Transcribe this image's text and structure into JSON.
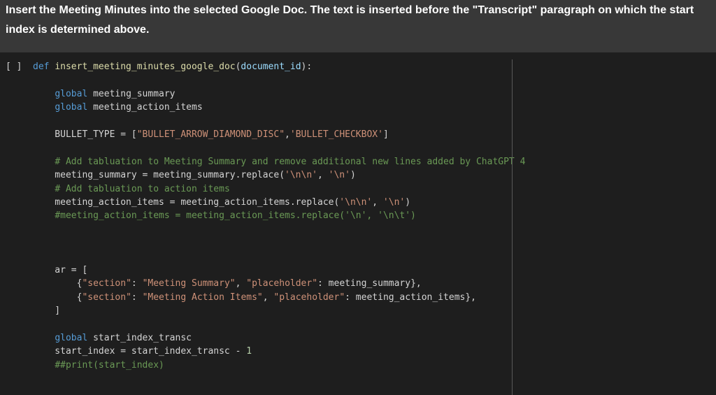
{
  "header": {
    "text": "Insert the Meeting Minutes into the selected Google Doc. The text is inserted before the \"Transcript\" paragraph on which the start index is determined above."
  },
  "cell": {
    "run_label": "[ ]"
  },
  "code_lines": [
    [
      [
        "keyword",
        "def"
      ],
      [
        "plain",
        " "
      ],
      [
        "function",
        "insert_meeting_minutes_google_doc"
      ],
      [
        "plain",
        "("
      ],
      [
        "param",
        "document_id"
      ],
      [
        "plain",
        "):"
      ]
    ],
    [],
    [
      [
        "plain",
        "    "
      ],
      [
        "keyword",
        "global"
      ],
      [
        "plain",
        " meeting_summary"
      ]
    ],
    [
      [
        "plain",
        "    "
      ],
      [
        "keyword",
        "global"
      ],
      [
        "plain",
        " meeting_action_items"
      ]
    ],
    [],
    [
      [
        "plain",
        "    BULLET_TYPE = ["
      ],
      [
        "string",
        "\"BULLET_ARROW_DIAMOND_DISC\""
      ],
      [
        "plain",
        ","
      ],
      [
        "string",
        "'BULLET_CHECKBOX'"
      ],
      [
        "plain",
        "]"
      ]
    ],
    [],
    [
      [
        "plain",
        "    "
      ],
      [
        "comment",
        "# Add tabluation to Meeting Summary and remove additional new lines added by ChatGPT 4"
      ]
    ],
    [
      [
        "plain",
        "    meeting_summary = meeting_summary.replace("
      ],
      [
        "string",
        "'\\n\\n'"
      ],
      [
        "plain",
        ", "
      ],
      [
        "string",
        "'\\n'"
      ],
      [
        "plain",
        ")"
      ]
    ],
    [
      [
        "plain",
        "    "
      ],
      [
        "comment",
        "# Add tabluation to action items"
      ]
    ],
    [
      [
        "plain",
        "    meeting_action_items = meeting_action_items.replace("
      ],
      [
        "string",
        "'\\n\\n'"
      ],
      [
        "plain",
        ", "
      ],
      [
        "string",
        "'\\n'"
      ],
      [
        "plain",
        ")"
      ]
    ],
    [
      [
        "plain",
        "    "
      ],
      [
        "comment",
        "#meeting_action_items = meeting_action_items.replace('\\n', '\\n\\t')"
      ]
    ],
    [],
    [],
    [],
    [
      [
        "plain",
        "    ar = ["
      ]
    ],
    [
      [
        "plain",
        "        {"
      ],
      [
        "string",
        "\"section\""
      ],
      [
        "plain",
        ": "
      ],
      [
        "string",
        "\"Meeting Summary\""
      ],
      [
        "plain",
        ", "
      ],
      [
        "string",
        "\"placeholder\""
      ],
      [
        "plain",
        ": meeting_summary},"
      ]
    ],
    [
      [
        "plain",
        "        {"
      ],
      [
        "string",
        "\"section\""
      ],
      [
        "plain",
        ": "
      ],
      [
        "string",
        "\"Meeting Action Items\""
      ],
      [
        "plain",
        ", "
      ],
      [
        "string",
        "\"placeholder\""
      ],
      [
        "plain",
        ": meeting_action_items},"
      ]
    ],
    [
      [
        "plain",
        "    ]"
      ]
    ],
    [],
    [
      [
        "plain",
        "    "
      ],
      [
        "keyword",
        "global"
      ],
      [
        "plain",
        " start_index_transc"
      ]
    ],
    [
      [
        "plain",
        "    start_index = start_index_transc - "
      ],
      [
        "number",
        "1"
      ]
    ],
    [
      [
        "plain",
        "    "
      ],
      [
        "comment",
        "##print(start_index)"
      ]
    ]
  ]
}
